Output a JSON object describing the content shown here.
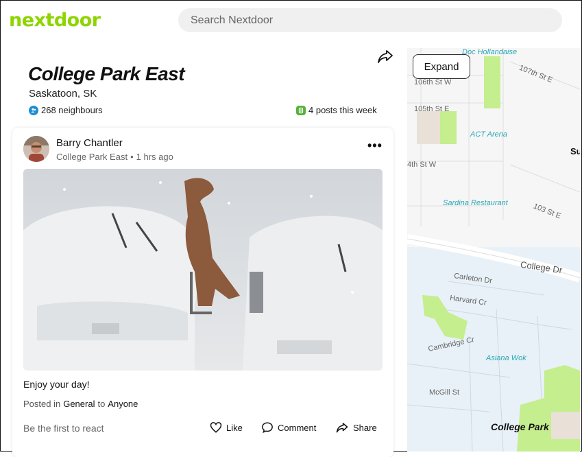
{
  "header": {
    "logo": "nextdoor",
    "search_placeholder": "Search Nextdoor"
  },
  "neighbourhood": {
    "name": "College Park East",
    "location": "Saskatoon, SK",
    "neighbours": "268 neighbours",
    "posts": "4 posts this week"
  },
  "post": {
    "author": "Barry Chantler",
    "neighbourhood": "College Park East",
    "separator": "•",
    "time": "1 hrs ago",
    "body": "Enjoy your day!",
    "posted_prefix": "Posted in",
    "category": "General",
    "to_word": "to",
    "audience": "Anyone",
    "react_prompt": "Be the first to react",
    "actions": {
      "like": "Like",
      "comment": "Comment",
      "share": "Share"
    }
  },
  "map": {
    "expand_label": "Expand",
    "streets": [
      "106th St W",
      "105th St E",
      "4th St W",
      "107th St E",
      "103 St E",
      "College Dr",
      "Carleton Dr",
      "Harvard Cr",
      "Cambridge Cr",
      "McGill St",
      "Su"
    ],
    "pois": [
      "Doc Hollandaise",
      "ACT Arena",
      "Sardina Restaurant",
      "Asiana Wok"
    ],
    "area": "College Park"
  },
  "colors": {
    "brand": "#8ed500",
    "map_green": "#c5ee8f",
    "poi": "#2aa7b8"
  }
}
